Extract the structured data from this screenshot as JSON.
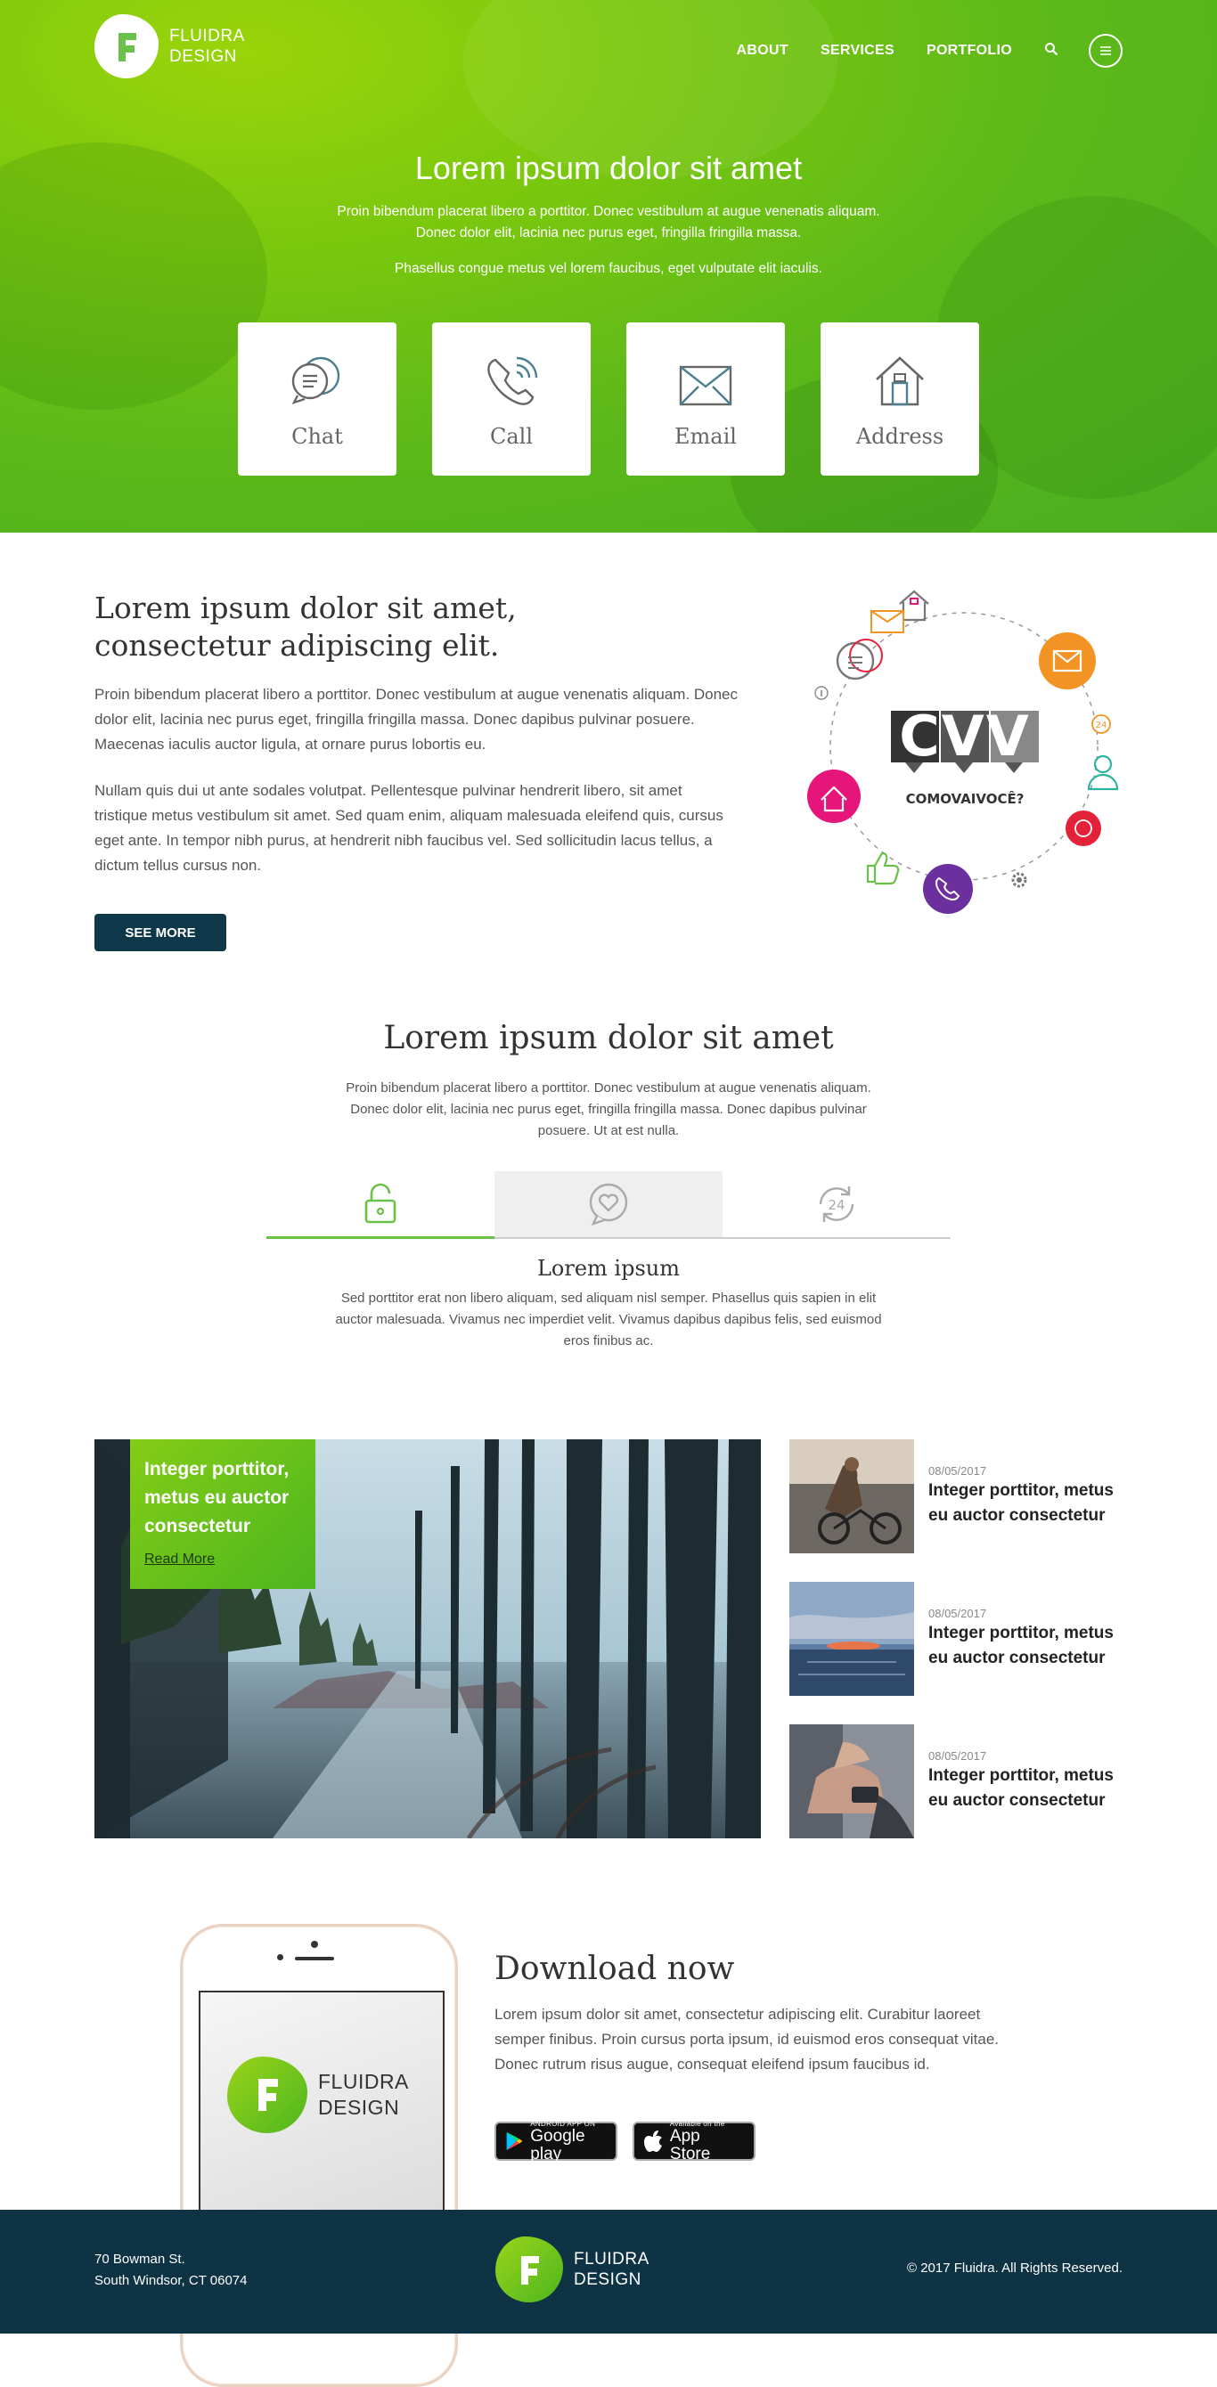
{
  "brand": {
    "line1": "FLUIDRA",
    "line2": "DESIGN"
  },
  "nav": {
    "items": [
      "ABOUT",
      "SERVICES",
      "PORTFOLIO"
    ]
  },
  "hero": {
    "title": "Lorem ipsum dolor sit amet",
    "text1": "Proin bibendum placerat libero a porttitor. Donec vestibulum at augue venenatis aliquam.",
    "text2": "Donec dolor elit, lacinia nec purus eget, fringilla fringilla massa.",
    "text3": "Phasellus congue metus vel lorem faucibus, eget vulputate elit iaculis.",
    "cards": [
      "Chat",
      "Call",
      "Email",
      "Address"
    ]
  },
  "about": {
    "title1": "Lorem ipsum dolor sit amet,",
    "title2": "consectetur adipiscing elit.",
    "para1_l1": "Proin bibendum placerat libero a porttitor. Donec vestibulum at augue venenatis aliquam. Donec",
    "para1_l2": "dolor elit, lacinia nec purus eget, fringilla fringilla massa. Donec dapibus pulvinar posuere.",
    "para1_l3": "Maecenas iaculis auctor ligula, at ornare purus lobortis eu.",
    "para2_l1": "Nullam quis dui ut ante sodales volutpat. Pellentesque pulvinar hendrerit libero, sit amet",
    "para2_l2": "tristique metus vestibulum sit amet. Sed quam enim, aliquam malesuada eleifend quis, cursus",
    "para2_l3": "eget ante. In tempor nibh purus, at hendrerit nibh faucibus vel. Sed sollicitudin lacus tellus, a",
    "para2_l4": "dictum tellus cursus non.",
    "button": "SEE MORE",
    "logo_text": "CVV",
    "logo_sub": "COMOVAIVOCÊ?",
    "badge_24": "24"
  },
  "features": {
    "title": "Lorem ipsum dolor sit amet",
    "text_l1": "Proin bibendum placerat libero a porttitor. Donec vestibulum at augue venenatis aliquam.",
    "text_l2": "Donec dolor elit, lacinia nec purus eget, fringilla fringilla massa. Donec dapibus pulvinar",
    "text_l3": "posuere. Ut at est nulla.",
    "tab_title": "Lorem ipsum",
    "tab_text_l1": "Sed porttitor erat non libero aliquam, sed aliquam nisl semper. Phasellus quis sapien in elit",
    "tab_text_l2": "auctor malesuada. Vivamus nec imperdiet velit. Vivamus dapibus dapibus felis, sed euismod",
    "tab_text_l3": "eros finibus ac.",
    "tab_24": "24"
  },
  "blog": {
    "main_title": "Integer porttitor, metus eu auctor consectetur",
    "read_more": "Read More",
    "posts": [
      {
        "date": "08/05/2017",
        "title": "Integer porttitor, metus eu auctor consectetur"
      },
      {
        "date": "08/05/2017",
        "title": "Integer porttitor, metus eu auctor consectetur"
      },
      {
        "date": "08/05/2017",
        "title": "Integer porttitor, metus eu auctor consectetur"
      }
    ]
  },
  "download": {
    "title": "Download now",
    "text": "Lorem ipsum dolor sit amet, consectetur adipiscing elit. Curabitur laoreet semper finibus. Proin cursus porta ipsum, id euismod eros consequat vitae. Donec rutrum risus augue, consequat eleifend ipsum faucibus id.",
    "google_small": "ANDROID APP ON",
    "google_big": "Google play",
    "apple_small": "Available on the",
    "apple_big": "App Store"
  },
  "footer": {
    "addr1": "70 Bowman St.",
    "addr2": "South Windsor, CT 06074",
    "copyright": "© 2017 Fluidra. All Rights Reserved."
  },
  "colors": {
    "green": "#6ac14a",
    "dark": "#0d3344",
    "orange": "#f39324",
    "pink": "#e5157a",
    "purple": "#6b2f9e",
    "red": "#e3223a"
  }
}
